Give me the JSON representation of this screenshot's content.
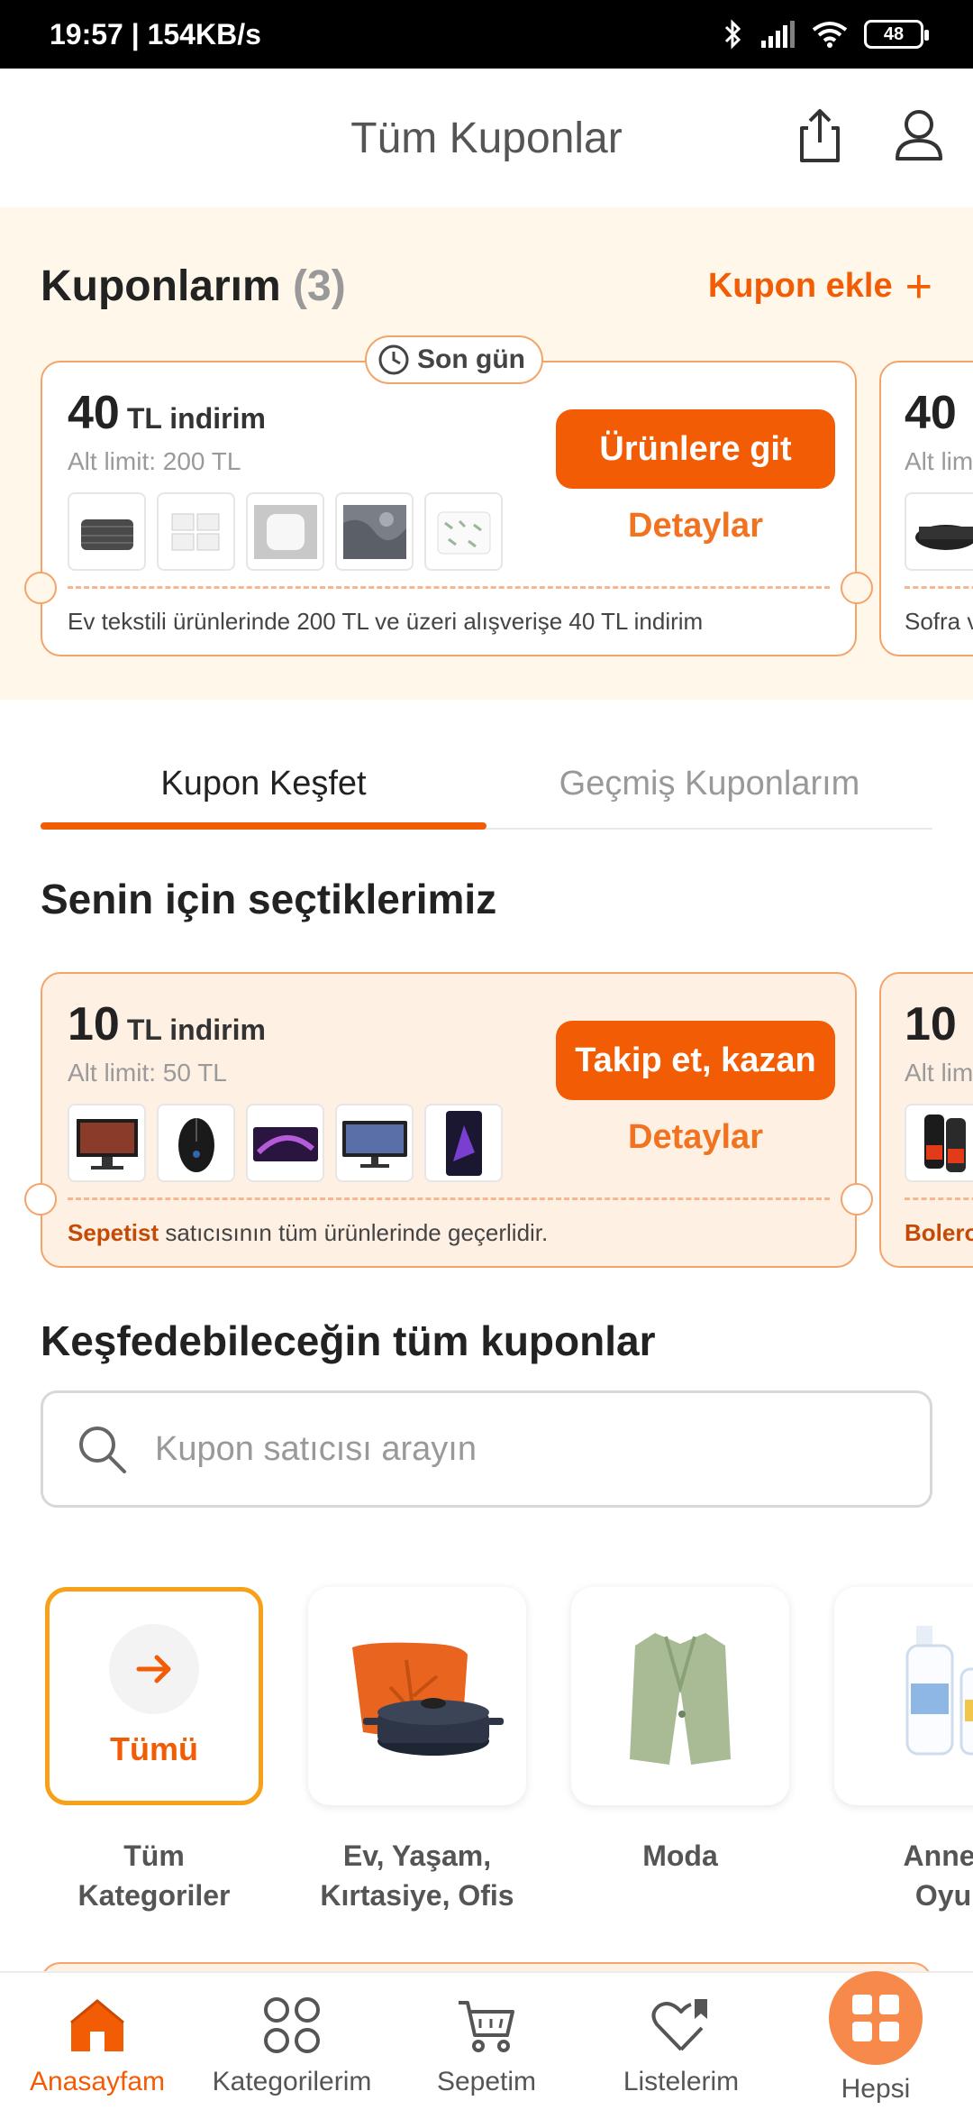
{
  "status_bar": {
    "time": "19:57 | 154KB/s",
    "battery": "48"
  },
  "header": {
    "title": "Tüm Kuponlar",
    "share_icon": "share-icon",
    "profile_icon": "user-icon"
  },
  "my_coupons": {
    "title": "Kuponlarım",
    "count": "(3)",
    "add_label": "Kupon ekle",
    "badge": "Son gün",
    "coupon": {
      "amount": "40",
      "amount_label": "TL indirim",
      "limit": "Alt limit: 200 TL",
      "button": "Ürünlere git",
      "details": "Detaylar",
      "description": "Ev tekstili ürünlerinde 200 TL ve üzeri alışverişe 40 TL indirim"
    },
    "peek": {
      "amount": "40",
      "limit": "Alt lim",
      "description": "Sofra v"
    }
  },
  "tabs": [
    {
      "label": "Kupon Keşfet",
      "active": true
    },
    {
      "label": "Geçmiş Kuponlarım",
      "active": false
    }
  ],
  "for_you": {
    "title": "Senin için seçtiklerimiz",
    "coupon": {
      "amount": "10",
      "amount_label": "TL indirim",
      "limit": "Alt limit: 50 TL",
      "button": "Takip et, kazan",
      "details": "Detaylar",
      "seller": "Sepetist",
      "description": " satıcısının tüm ürünlerinde geçerlidir."
    },
    "peek": {
      "amount": "10",
      "limit": "Alt lim",
      "seller": "Bolero"
    }
  },
  "all_coupons": {
    "title": "Keşfedebileceğin tüm kuponlar",
    "search_placeholder": "Kupon satıcısı arayın"
  },
  "categories": [
    {
      "label": "Tüm\nKategoriler",
      "card_text": "Tümü",
      "selected": true
    },
    {
      "label": "Ev, Yaşam,\nKırtasiye, Ofis",
      "selected": false
    },
    {
      "label": "Moda",
      "selected": false
    },
    {
      "label": "Anne,\nOyu",
      "selected": false
    }
  ],
  "bottom_nav": [
    {
      "label": "Anasayfam",
      "icon": "home-icon",
      "active": true
    },
    {
      "label": "Kategorilerim",
      "icon": "categories-icon",
      "active": false
    },
    {
      "label": "Sepetim",
      "icon": "cart-icon",
      "active": false
    },
    {
      "label": "Listelerim",
      "icon": "heart-list-icon",
      "active": false
    },
    {
      "label": "Hepsi",
      "icon": "hepsi-grid-icon",
      "active": false
    }
  ],
  "colors": {
    "accent": "#f25c05",
    "band": "#fff8ea",
    "coupon_tint": "#fff0e4",
    "border": "#f4a36a"
  }
}
